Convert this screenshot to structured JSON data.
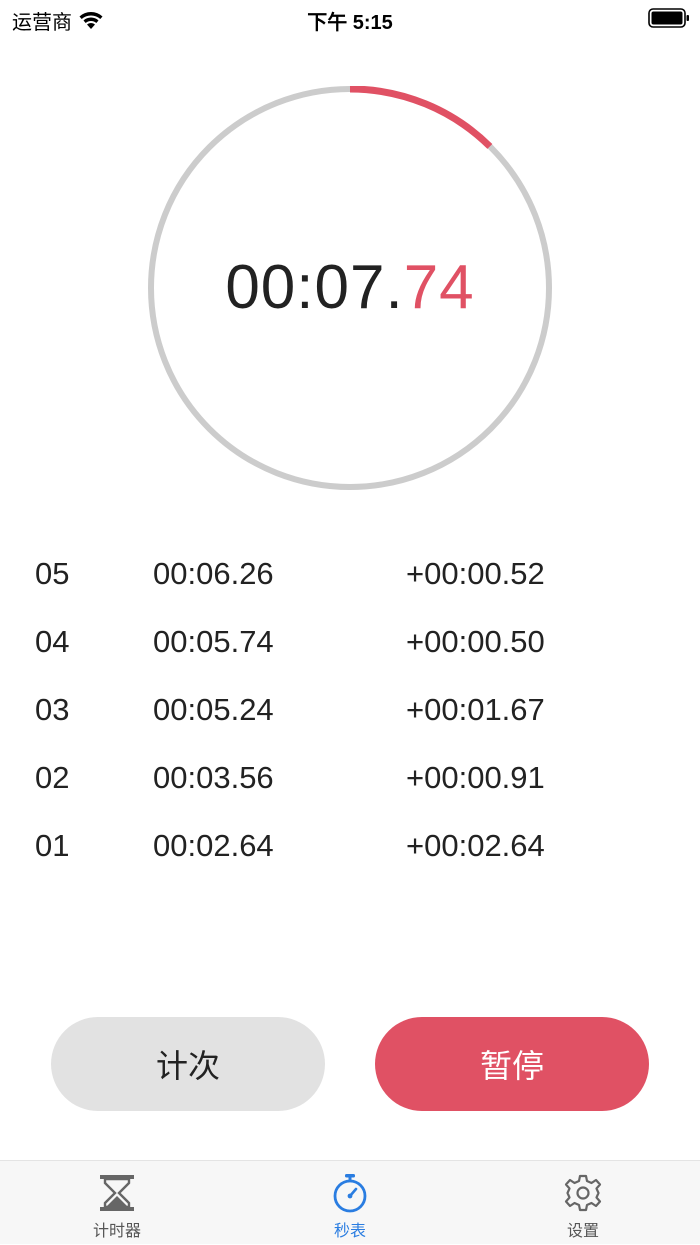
{
  "status_bar": {
    "carrier": "运营商",
    "time": "下午 5:15"
  },
  "stopwatch": {
    "elapsed_main": "00:07.",
    "elapsed_centis": "74",
    "progress": 0.124,
    "accent_color": "#e05164",
    "track_color": "#cccccc"
  },
  "laps": [
    {
      "index": "05",
      "total": "00:06.26",
      "split": "+00:00.52"
    },
    {
      "index": "04",
      "total": "00:05.74",
      "split": "+00:00.50"
    },
    {
      "index": "03",
      "total": "00:05.24",
      "split": "+00:01.67"
    },
    {
      "index": "02",
      "total": "00:03.56",
      "split": "+00:00.91"
    },
    {
      "index": "01",
      "total": "00:02.64",
      "split": "+00:02.64"
    }
  ],
  "buttons": {
    "lap_label": "计次",
    "pause_label": "暂停"
  },
  "tab_bar": {
    "active_color": "#2a7de1",
    "tabs": [
      {
        "label": "计时器",
        "icon": "hourglass-icon"
      },
      {
        "label": "秒表",
        "icon": "stopwatch-icon"
      },
      {
        "label": "设置",
        "icon": "gear-icon"
      }
    ]
  }
}
